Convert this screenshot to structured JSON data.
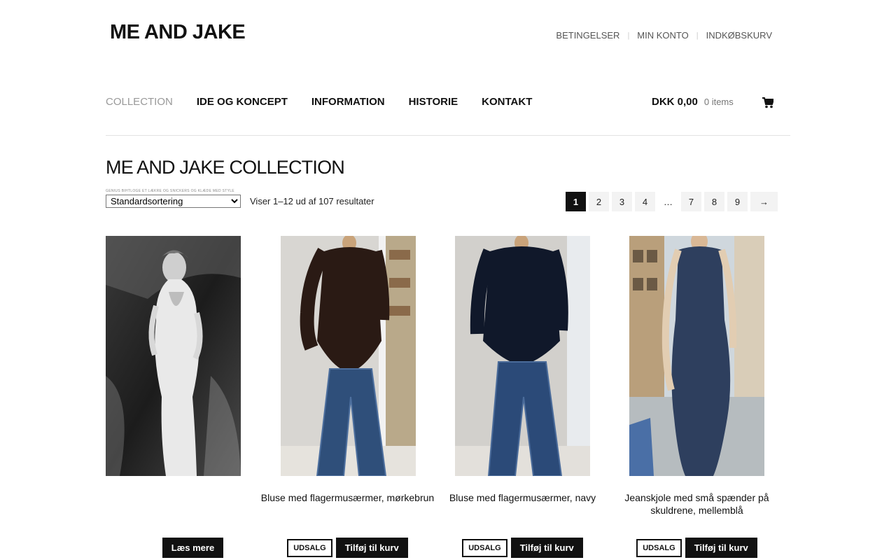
{
  "brand": {
    "logo_text": "ME AND JAKE"
  },
  "top_nav": [
    "BETINGELSER",
    "MIN KONTO",
    "INDKØBSKURV"
  ],
  "main_nav": [
    {
      "label": "COLLECTION",
      "active": true
    },
    {
      "label": "IDE OG KONCEPT"
    },
    {
      "label": "INFORMATION"
    },
    {
      "label": "HISTORIE"
    },
    {
      "label": "KONTAKT"
    }
  ],
  "cart": {
    "total": "DKK 0,00",
    "items": "0 items",
    "icon": "shopping-cart-icon"
  },
  "page_title": "ME AND JAKE COLLECTION",
  "tiny_note": "GENIUS BIHTLOGE ET LÆKRE OG SNICKERS OG KLÆDE MED STYLE",
  "sort": {
    "selected": "Standardsortering"
  },
  "result_count": "Viser 1–12 ud af 107 resultater",
  "pagination": [
    "1",
    "2",
    "3",
    "4",
    "…",
    "7",
    "8",
    "9",
    "→"
  ],
  "products": [
    {
      "name": "",
      "buttons": {
        "primary": "Læs mere"
      }
    },
    {
      "name": "Bluse med flagermusærmer, mørkebrun",
      "buttons": {
        "sale": "UDSALG",
        "primary": "Tilføj til kurv"
      }
    },
    {
      "name": "Bluse med flagermusærmer, navy",
      "buttons": {
        "sale": "UDSALG",
        "primary": "Tilføj til kurv"
      }
    },
    {
      "name": "Jeanskjole med små spænder på skuldrene, mellemblå",
      "buttons": {
        "sale": "UDSALG",
        "primary": "Tilføj til kurv"
      }
    }
  ]
}
